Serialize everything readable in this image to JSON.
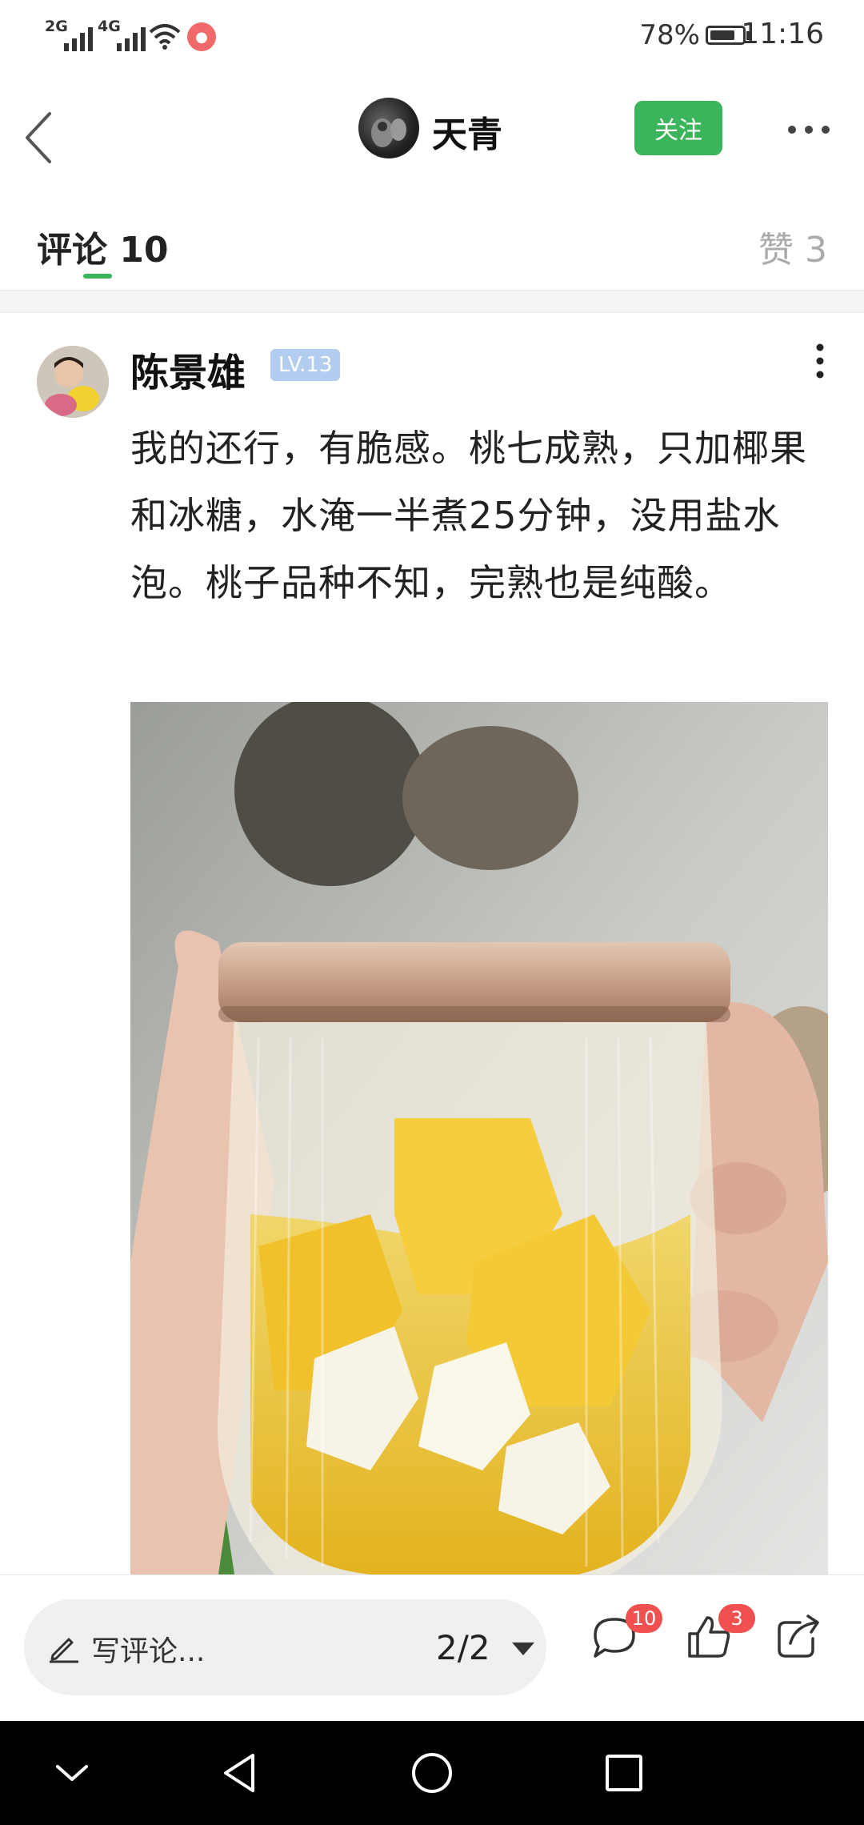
{
  "status_bar": {
    "signal_1": "2G",
    "signal_2": "4G",
    "battery": "78%",
    "battery_fraction": 0.78,
    "time": "11:16"
  },
  "header": {
    "author_name": "天青",
    "follow_label": "关注",
    "back_icon": "back-chevron-icon",
    "more_icon": "more-dots-icon"
  },
  "tabs": {
    "comments_label": "评论 10",
    "likes_label": "赞 3"
  },
  "comment": {
    "username": "陈景雄",
    "level": "LV.13",
    "text": "我的还行，有脆感。桃七成熟，只加椰果和冰糖，水淹一半煮25分钟，没用盐水泡。桃子品种不知，完熟也是纯酸。"
  },
  "bottom_bar": {
    "write_placeholder": "写评论...",
    "page_indicator": "2/2",
    "comment_count": "10",
    "like_count": "3"
  },
  "colors": {
    "accent_green": "#3cb45c",
    "badge_red": "#f05050",
    "level_badge": "#b3cdf0"
  }
}
